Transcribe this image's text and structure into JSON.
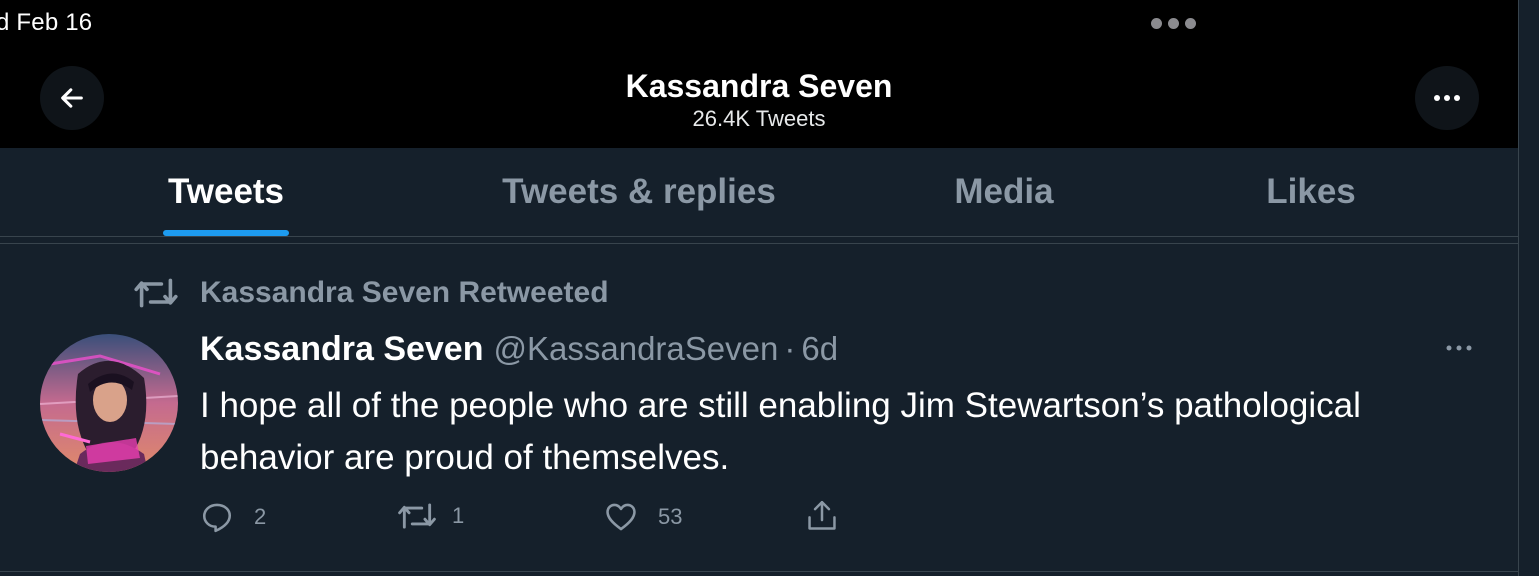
{
  "statusbar": {
    "date": "d Feb 16"
  },
  "header": {
    "title": "Kassandra Seven",
    "subtitle": "26.4K Tweets"
  },
  "icons": {
    "back": "arrow-left-icon",
    "more": "more-horizontal-icon",
    "retweet": "retweet-icon",
    "reply": "reply-icon",
    "like": "heart-icon",
    "share": "share-icon"
  },
  "tabs": [
    {
      "label": "Tweets",
      "active": true
    },
    {
      "label": "Tweets & replies",
      "active": false
    },
    {
      "label": "Media",
      "active": false
    },
    {
      "label": "Likes",
      "active": false
    }
  ],
  "tweet": {
    "retweeted_by": "Kassandra Seven Retweeted",
    "display_name": "Kassandra Seven",
    "handle": "@KassandraSeven",
    "separator": "·",
    "age": "6d",
    "text": "I hope all of the people who are still enabling Jim Stewartson’s pathological behavior are proud of themselves.",
    "replies": "2",
    "retweets": "1",
    "likes": "53"
  },
  "colors": {
    "background": "#15202b",
    "header_bg": "#000000",
    "accent": "#1d9bf0",
    "muted_text": "#8b98a5",
    "divider": "#38444d"
  }
}
